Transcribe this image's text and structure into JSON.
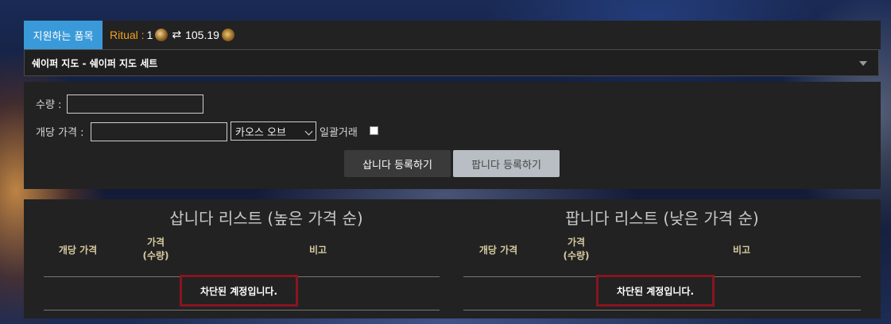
{
  "topbar": {
    "supported_items_label": "지원하는 품목",
    "league_label": "Ritual :",
    "rate_left": "1",
    "swap_symbol": "⇄",
    "rate_right": "105.19",
    "left_currency_icon": "exalted-orb-icon",
    "right_currency_icon": "chaos-orb-icon"
  },
  "item_select": {
    "value": "쉐이퍼 지도 - 쉐이퍼 지도 세트"
  },
  "form": {
    "quantity_label": "수량 :",
    "quantity_value": "",
    "unit_price_label": "개당 가격 :",
    "unit_price_value": "",
    "currency_selected": "카오스 오브",
    "bulk_label": "일괄거래",
    "bulk_checked": false,
    "buy_button": "삽니다 등록하기",
    "sell_button": "팝니다 등록하기"
  },
  "buy_list": {
    "title": "삽니다 리스트 (높은 가격 순)",
    "columns": [
      "개당 가격",
      "가격\n(수량)",
      "비고"
    ],
    "message": "차단된 계정입니다."
  },
  "sell_list": {
    "title": "팝니다 리스트 (낮은 가격 순)",
    "columns": [
      "개당 가격",
      "가격\n(수량)",
      "비고"
    ],
    "message": "차단된 계정입니다."
  },
  "colors": {
    "tab_blue": "#3a9ad9",
    "league_orange": "#f0a020",
    "panel_bg": "#222222",
    "blocked_border": "#8a1420",
    "header_gold": "#d6c9a0"
  }
}
